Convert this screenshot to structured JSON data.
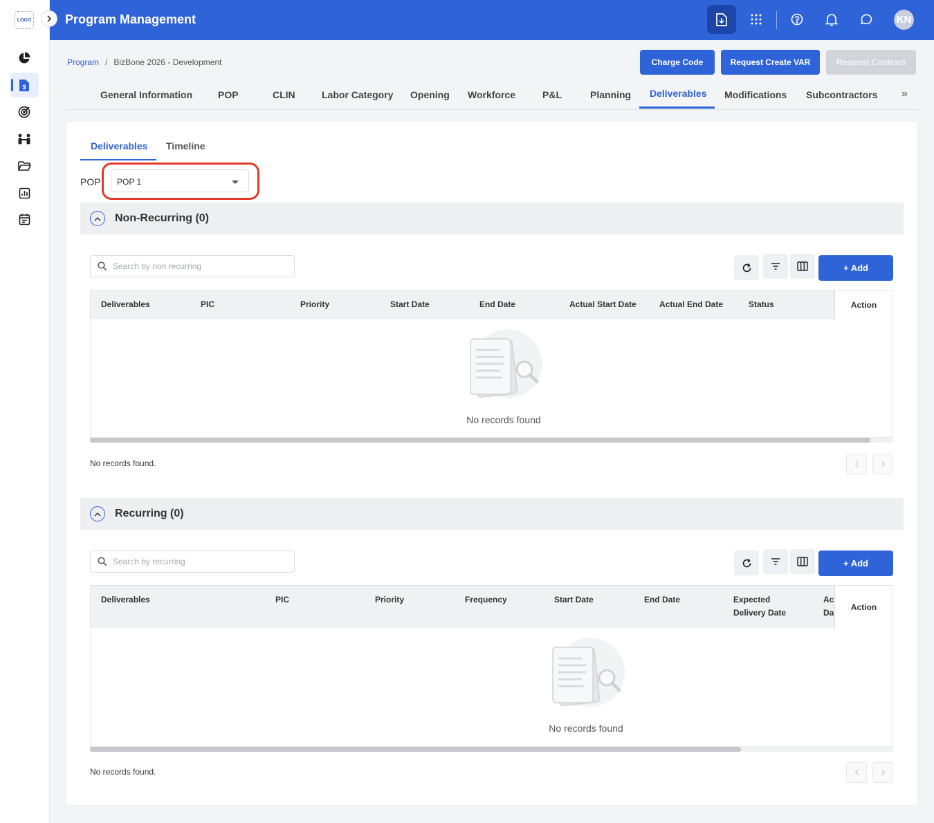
{
  "sidebar": {
    "logo_text": "LOGO",
    "items": [
      {
        "icon": "pie-chart-icon"
      },
      {
        "icon": "document-dollar-icon",
        "active": true
      },
      {
        "icon": "target-icon"
      },
      {
        "icon": "team-icon"
      },
      {
        "icon": "folder-icon"
      },
      {
        "icon": "report-icon"
      },
      {
        "icon": "calendar-icon"
      }
    ]
  },
  "header": {
    "title": "Program Management",
    "avatar_initials": "KN"
  },
  "breadcrumb": {
    "root": "Program",
    "separator": "/",
    "current": "BizBone 2026 - Development"
  },
  "actions": {
    "charge_code": "Charge Code",
    "request_var": "Request Create VAR",
    "request_contract": "Request Contract"
  },
  "main_tabs": [
    "General Information",
    "POP",
    "CLIN",
    "Labor Category",
    "Opening",
    "Workforce",
    "P&L",
    "Planning",
    "Deliverables",
    "Modifications",
    "Subcontractors"
  ],
  "main_tabs_more": "»",
  "sub_tabs": [
    "Deliverables",
    "Timeline"
  ],
  "pop_filter": {
    "label": "POP",
    "value": "POP 1"
  },
  "non_recurring": {
    "title": "Non-Recurring (0)",
    "search_placeholder": "Search by non recurring",
    "add_label": "+ Add",
    "columns": [
      "Deliverables",
      "PIC",
      "Priority",
      "Start Date",
      "End Date",
      "Actual Start Date",
      "Actual End Date",
      "Status"
    ],
    "action_column": "Action",
    "empty_text": "No records found",
    "footer_text": "No records found."
  },
  "recurring": {
    "title": "Recurring (0)",
    "search_placeholder": "Search by recurring",
    "add_label": "+ Add",
    "columns": [
      "Deliverables",
      "PIC",
      "Priority",
      "Frequency",
      "Start Date",
      "End Date",
      "Expected Delivery Date",
      "Ac Da"
    ],
    "action_column": "Action",
    "empty_text": "No records found",
    "footer_text": "No records found."
  }
}
